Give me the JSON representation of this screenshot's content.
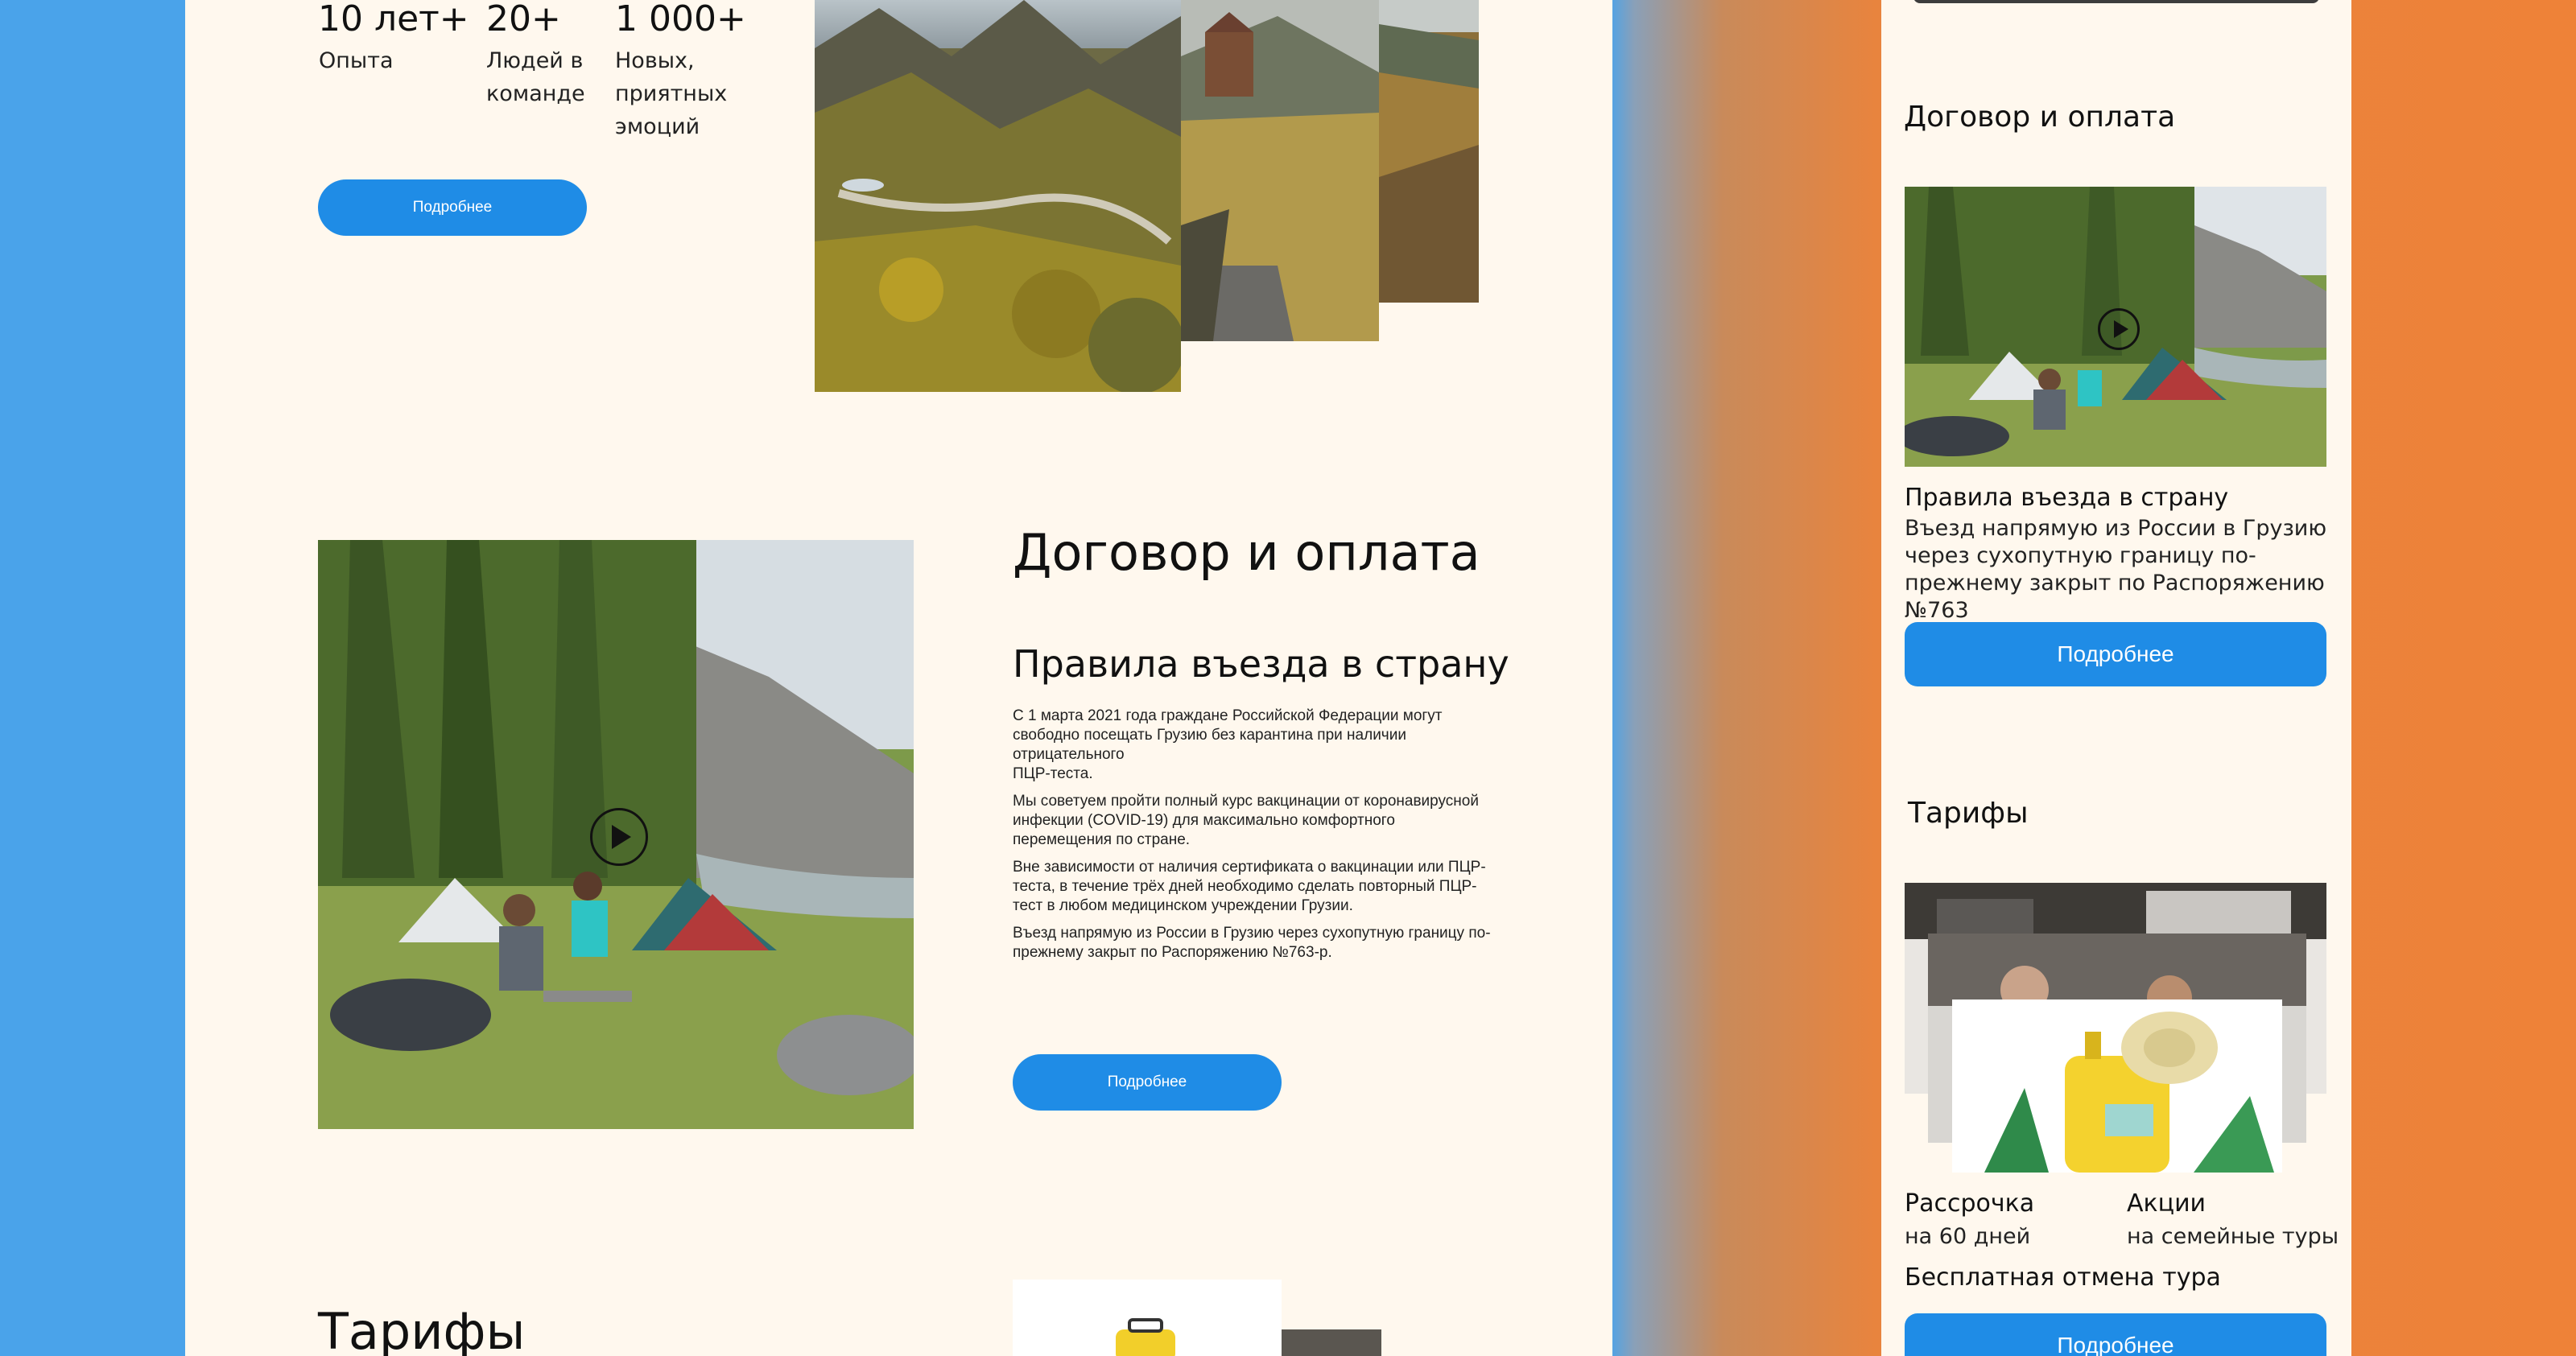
{
  "desktop": {
    "stats": [
      {
        "value": "10 лет+",
        "label": "Опыта"
      },
      {
        "value": "20+",
        "label": "Людей в команде"
      },
      {
        "value": "1 000+",
        "label": "Новых, приятных эмоций"
      }
    ],
    "more_button_1": "Подробнее",
    "section_title": "Договор и оплата",
    "subtitle": "Правила въезда в страну",
    "paragraphs": [
      "С 1 марта 2021 года граждане Российской Федерации могут свободно посещать Грузию без карантина при наличии отрицательного\nПЦР-теста.",
      "Мы советуем пройти полный курс вакцинации от коронавирусной инфекции (COVID-19) для максимально комфортного перемещения по стране.",
      "Вне зависимости от наличия сертификата о вакцинации или ПЦР-теста, в течение трёх дней необходимо сделать повторный ПЦР-тест в любом медицинском учреждении Грузии.",
      "Въезд напрямую из России в Грузию через сухопутную границу по-прежнему закрыт по Распоряжению №763-р."
    ],
    "more_button_2": "Подробнее",
    "tariffs_title": "Тарифы"
  },
  "mobile": {
    "section_title": "Договор и оплата",
    "rules_heading": "Правила въезда в страну",
    "rules_text": "Въезд напрямую из России в Грузию через сухопутную границу по-прежнему закрыт по Распоряжению №763",
    "more_button_1": "Подробнее",
    "tariffs_title": "Тарифы",
    "features": [
      {
        "title": "Рассрочка",
        "subtitle": "на 60 дней"
      },
      {
        "title": "Акции",
        "subtitle": "на семейные туры"
      }
    ],
    "free_cancel": "Бесплатная отмена тура",
    "more_button_2": "Подробнее"
  },
  "colors": {
    "accent": "#1f8ce6",
    "page_bg": "#fff8ee",
    "left_bg": "#4aa3ea",
    "right_bg": "#ee8238"
  }
}
